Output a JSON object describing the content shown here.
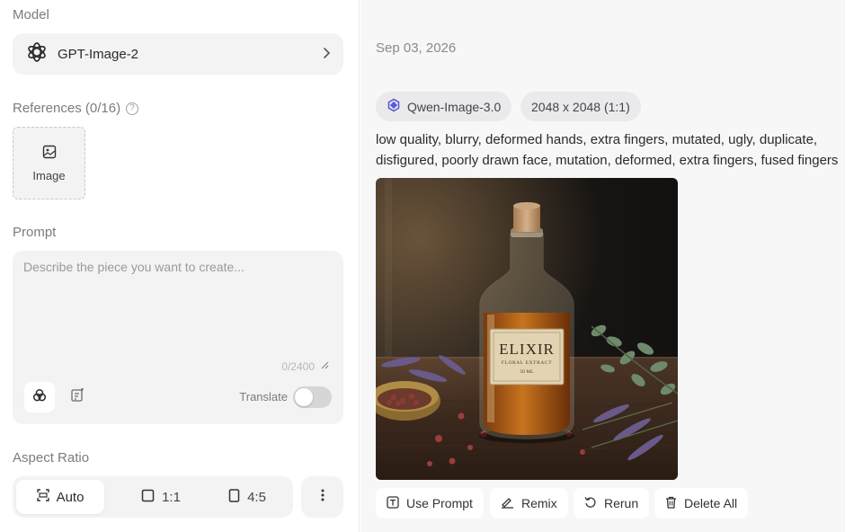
{
  "sidebar": {
    "model_label": "Model",
    "model_name": "GPT-Image-2",
    "model_icon": "openai-logo-icon",
    "references_label": "References (0/16)",
    "reference_upload_label": "Image",
    "prompt_label": "Prompt",
    "prompt_placeholder": "Describe the piece you want to create...",
    "prompt_value": "",
    "prompt_counter": "0/2400",
    "translate_label": "Translate",
    "translate_enabled": false,
    "aspect_ratio_label": "Aspect Ratio",
    "aspect_options": [
      {
        "label": "Auto",
        "icon": "auto-ratio-icon",
        "selected": true
      },
      {
        "label": "1:1",
        "icon": "square-ratio-icon",
        "selected": false
      },
      {
        "label": "4:5",
        "icon": "portrait-ratio-icon",
        "selected": false
      }
    ]
  },
  "result": {
    "date": "Sep 03, 2026",
    "model_tag": "Qwen-Image-3.0",
    "size_tag": "2048 x 2048 (1:1)",
    "negative_prompt_line1": "low quality, blurry, deformed hands, extra fingers, mutated, ugly, duplicate,",
    "negative_prompt_line2": "disfigured, poorly drawn face, mutation, deformed, extra fingers, fused fingers",
    "image_label_title": "ELIXIR",
    "image_label_sub": "FLORAL EXTRACT",
    "image_label_vol": "50 ML",
    "actions": {
      "use_prompt": "Use Prompt",
      "remix": "Remix",
      "rerun": "Rerun",
      "delete_all": "Delete All"
    }
  },
  "colors": {
    "panel_bg": "#f3f3f4",
    "right_bg": "#f7f7f8",
    "tag_bg": "#eaeaec",
    "muted_text": "#7c7c80"
  }
}
